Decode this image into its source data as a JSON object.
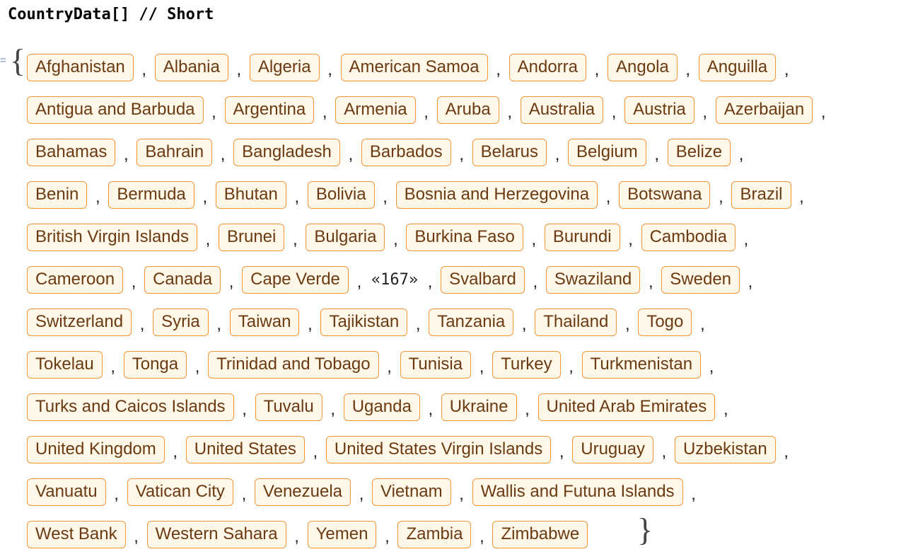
{
  "input": {
    "code": "CountryData[] // Short"
  },
  "output": {
    "marker": "=",
    "open_brace": "{",
    "close_brace": "}",
    "separator": ",",
    "elision": "«167»",
    "rows": [
      [
        "Afghanistan",
        "Albania",
        "Algeria",
        "American Samoa",
        "Andorra",
        "Angola",
        "Anguilla"
      ],
      [
        "Antigua and Barbuda",
        "Argentina",
        "Armenia",
        "Aruba",
        "Australia",
        "Austria",
        "Azerbaijan"
      ],
      [
        "Bahamas",
        "Bahrain",
        "Bangladesh",
        "Barbados",
        "Belarus",
        "Belgium",
        "Belize"
      ],
      [
        "Benin",
        "Bermuda",
        "Bhutan",
        "Bolivia",
        "Bosnia and Herzegovina",
        "Botswana",
        "Brazil"
      ],
      [
        "British Virgin Islands",
        "Brunei",
        "Bulgaria",
        "Burkina Faso",
        "Burundi",
        "Cambodia"
      ],
      [
        "Cameroon",
        "Canada",
        "Cape Verde",
        "«167»",
        "Svalbard",
        "Swaziland",
        "Sweden"
      ],
      [
        "Switzerland",
        "Syria",
        "Taiwan",
        "Tajikistan",
        "Tanzania",
        "Thailand",
        "Togo"
      ],
      [
        "Tokelau",
        "Tonga",
        "Trinidad and Tobago",
        "Tunisia",
        "Turkey",
        "Turkmenistan"
      ],
      [
        "Turks and Caicos Islands",
        "Tuvalu",
        "Uganda",
        "Ukraine",
        "United Arab Emirates"
      ],
      [
        "United Kingdom",
        "United States",
        "United States Virgin Islands",
        "Uruguay",
        "Uzbekistan"
      ],
      [
        "Vanuatu",
        "Vatican City",
        "Venezuela",
        "Vietnam",
        "Wallis and Futuna Islands"
      ],
      [
        "West Bank",
        "Western Sahara",
        "Yemen",
        "Zambia",
        "Zimbabwe"
      ]
    ]
  },
  "colors": {
    "chip_border": "#f2963a",
    "chip_background": "#fff8e9",
    "chip_text": "#6b3a12"
  }
}
